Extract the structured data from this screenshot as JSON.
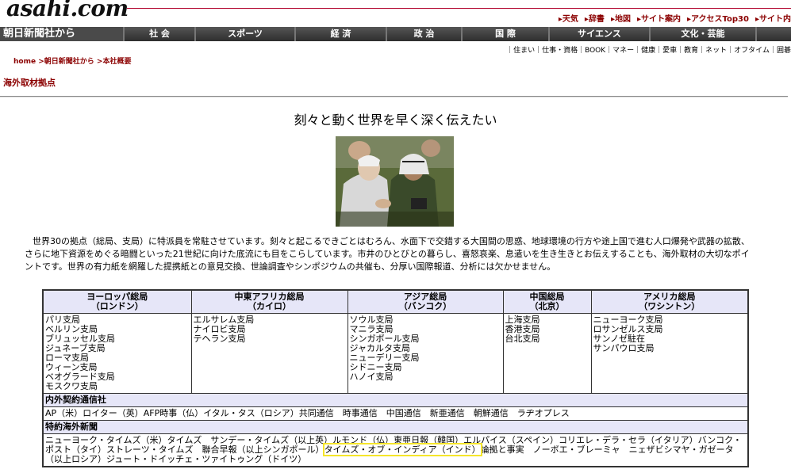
{
  "header": {
    "logo": "asahi.com",
    "toplinks": [
      "天気",
      "辞書",
      "地図",
      "サイト案内",
      "アクセスTop30",
      "サイト内"
    ]
  },
  "nav": {
    "home": "朝日新聞社から",
    "items": [
      "社 会",
      "スポーツ",
      "経 済",
      "政 治",
      "国 際",
      "サイエンス",
      "文化・芸能"
    ]
  },
  "sublinks": "｜住まい｜仕事・資格｜BOOK｜マネー｜健康｜愛車｜教育｜ネット｜オフタイム｜囲碁",
  "breadcrumb": {
    "home": "home",
    "level1": ">朝日新聞社から",
    "level2": ">本社概要"
  },
  "section_title": "海外取材拠点",
  "headline": "刻々と動く世界を早く深く伝えたい",
  "intro": "世界30の拠点（総局、支局）に特派員を常駐させています。刻々と起こるできごとはむろん、水面下で交錯する大国間の思惑、地球環境の行方や途上国で進む人口爆発や武器の拡散、さらに地下資源をめぐる暗闘といった21世紀に向けた底流にも目をこらしています。市井のひとびとの暮らし、喜怒哀楽、息遣いを生き生きとお伝えすることも、海外取材の大切なポイントです。世界の有力紙を網羅した提携紙との意見交換、世論調査やシンポジウムの共催も、分厚い国際報道、分析には欠かせません。",
  "bureaus": [
    {
      "title": "ヨーロッパ総局",
      "city": "（ロンドン）",
      "offices": [
        "パリ支局",
        "ベルリン支局",
        "ブリュッセル支局",
        "ジュネーブ支局",
        "ローマ支局",
        "ウィーン支局",
        "ベオグラード支局",
        "モスクワ支局"
      ]
    },
    {
      "title": "中東アフリカ総局",
      "city": "（カイロ）",
      "offices": [
        "エルサレム支局",
        "ナイロビ支局",
        "テヘラン支局"
      ]
    },
    {
      "title": "アジア総局",
      "city": "（バンコク）",
      "offices": [
        "ソウル支局",
        "マニラ支局",
        "シンガポール支局",
        "ジャカルタ支局",
        "ニューデリー支局",
        "シドニー支局",
        "ハノイ支局"
      ]
    },
    {
      "title": "中国総局",
      "city": "（北京）",
      "offices": [
        "上海支局",
        "香港支局",
        "台北支局"
      ]
    },
    {
      "title": "アメリカ総局",
      "city": "（ワシントン）",
      "offices": [
        "ニューヨーク支局",
        "ロサンゼルス支局",
        "サンノゼ駐在",
        "サンパウロ支局"
      ]
    }
  ],
  "agencies": {
    "title": "内外契約通信社",
    "text": "AP（米）ロイター（英）AFP時事（仏）イタル・タス（ロシア）共同通信　時事通信　中国通信　新亜通信　朝鮮通信　ラヂオプレス"
  },
  "partners": {
    "title": "特約海外新聞",
    "before": "ニューヨーク・タイムズ（米）タイムズ　サンデー・タイムズ（以上英）ルモンド（仏）東亜日報（韓国）エルパイス（スペイン）コリエレ・デラ・セラ（イタリア）バンコク・ポスト（タイ）ストレーツ・タイムズ　聯合早報（以上シンガポール）",
    "highlighted": "タイムズ・オブ・インディア（インド）",
    "after": "論拠と事実　ノーボエ・ブレーミャ　ニェザビシマヤ・ガゼータ（以上ロシア）ジュート・ドイッチェ・ツァイトゥング（ドイツ）"
  },
  "colors": {
    "accent": "#8b0000",
    "header_bg": "#e6e6f8",
    "highlight": "#f5e52a"
  }
}
